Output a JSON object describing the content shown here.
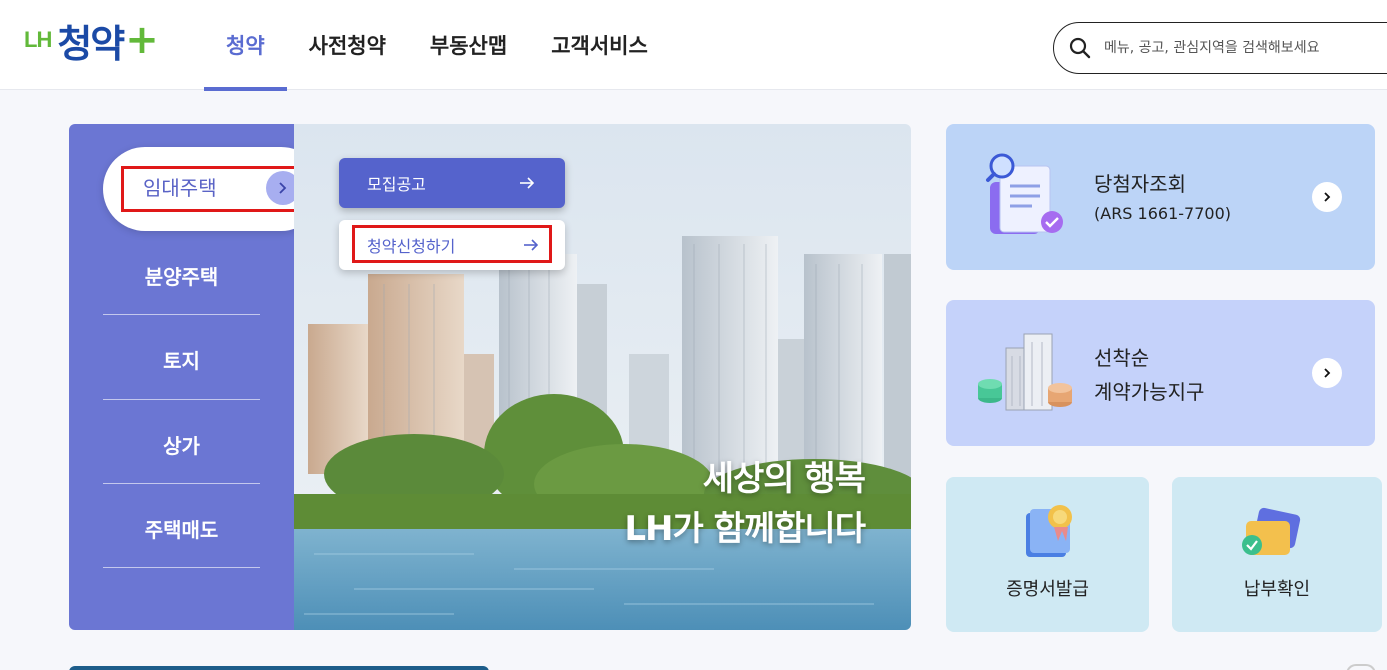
{
  "header": {
    "logo_lh": "LH",
    "logo_main": "청약",
    "logo_plus": "+",
    "nav": [
      "청약",
      "사전청약",
      "부동산맵",
      "고객서비스"
    ],
    "active_nav": "청약",
    "search_placeholder": "메뉴, 공고, 관심지역을 검색해보세요"
  },
  "left_menu": {
    "selected": "임대주택",
    "items": [
      "분양주택",
      "토지",
      "상가",
      "주택매도"
    ]
  },
  "submenu": {
    "primary": "모집공고",
    "secondary": "청약신청하기"
  },
  "hero": {
    "line1": "세상의 행복",
    "line2": "LH가 함께합니다"
  },
  "cards": {
    "winner": {
      "title": "당첨자조회",
      "sub": "(ARS 1661-7700)"
    },
    "first_come": {
      "title1": "선착순",
      "title2": "계약가능지구"
    },
    "certificate": {
      "label": "증명서발급"
    },
    "payment": {
      "label": "납부확인"
    }
  },
  "colors": {
    "accent": "#5a6cd1",
    "panel": "#6b76d3",
    "highlight_border": "#e01818"
  },
  "icons": [
    "search-icon",
    "chevron-right-icon",
    "arrow-right-icon",
    "document-check-icon",
    "building-coins-icon",
    "certificate-icon",
    "wallet-icon"
  ]
}
